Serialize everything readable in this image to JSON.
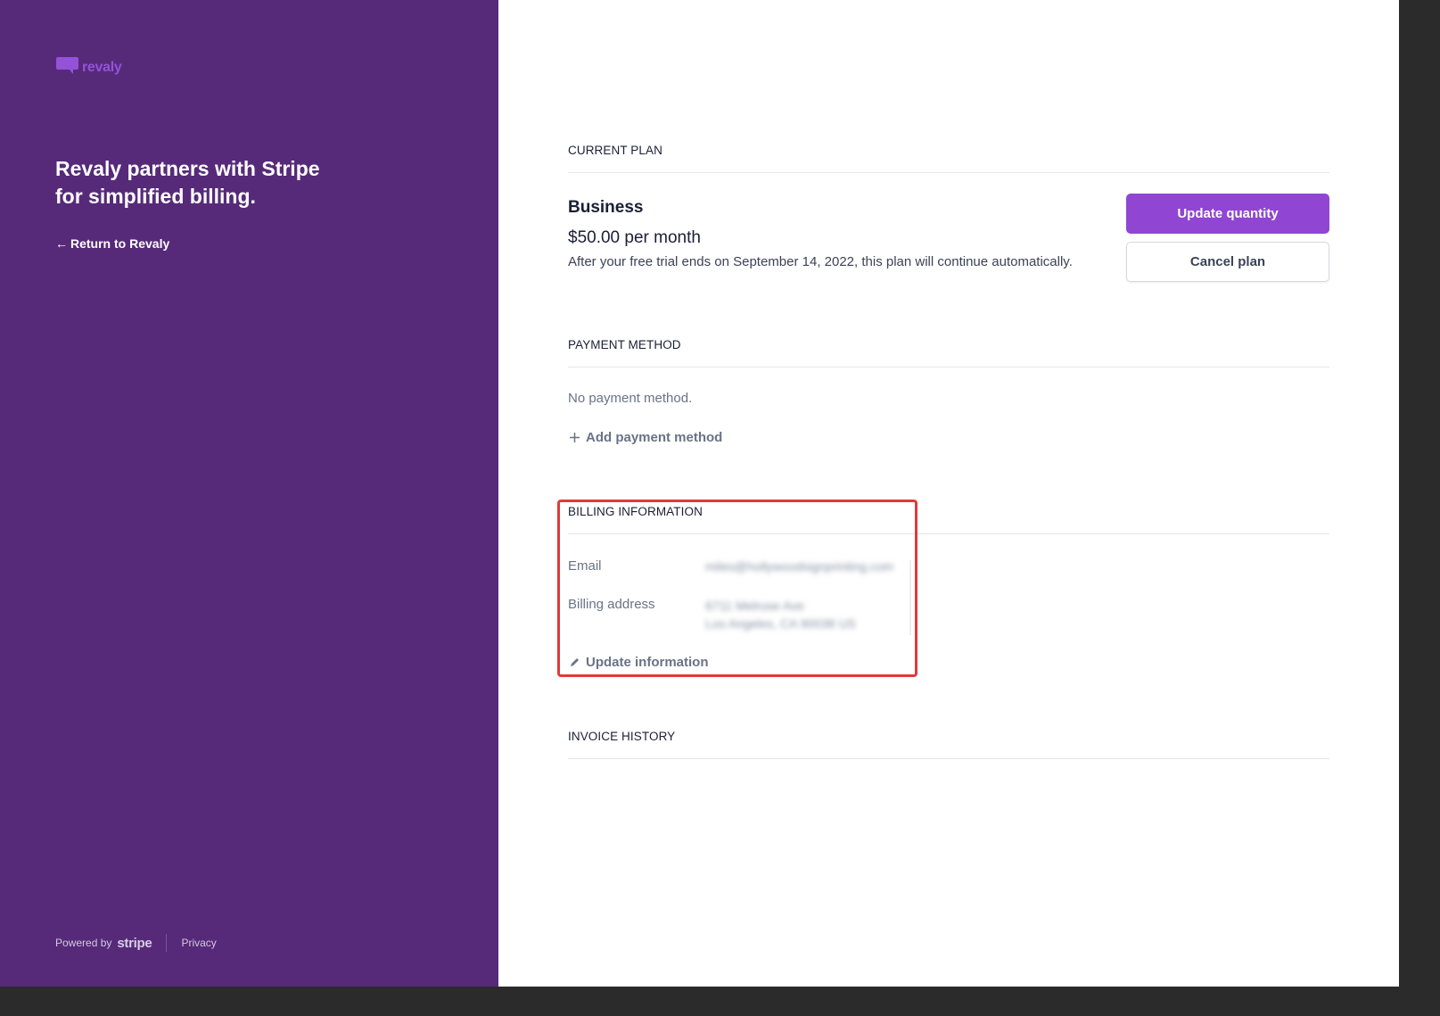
{
  "sidebar": {
    "logo_text": "revaly",
    "headline": "Revaly partners with Stripe for simplified billing.",
    "return_link": "Return to Revaly",
    "footer": {
      "powered_by": "Powered by",
      "stripe": "stripe",
      "privacy": "Privacy"
    }
  },
  "current_plan": {
    "section_title": "CURRENT PLAN",
    "plan_name": "Business",
    "price": "$50.00 per month",
    "note": "After your free trial ends on September 14, 2022, this plan will continue automatically.",
    "update_quantity_label": "Update quantity",
    "cancel_plan_label": "Cancel plan"
  },
  "payment_method": {
    "section_title": "PAYMENT METHOD",
    "empty_text": "No payment method.",
    "add_label": "Add payment method"
  },
  "billing_information": {
    "section_title": "BILLING INFORMATION",
    "email_label": "Email",
    "email_value": "miles@hollywoodsignprinting.com",
    "address_label": "Billing address",
    "address_line1": "6711 Melrose Ave",
    "address_line2": "Los Angeles, CA 90038 US",
    "update_label": "Update information"
  },
  "invoice_history": {
    "section_title": "INVOICE HISTORY"
  },
  "colors": {
    "sidebar_bg": "#562a79",
    "accent": "#9046d2",
    "highlight": "#e0393e"
  },
  "icons": {
    "back": "arrow-left-icon",
    "add": "plus-icon",
    "edit": "pencil-icon"
  }
}
